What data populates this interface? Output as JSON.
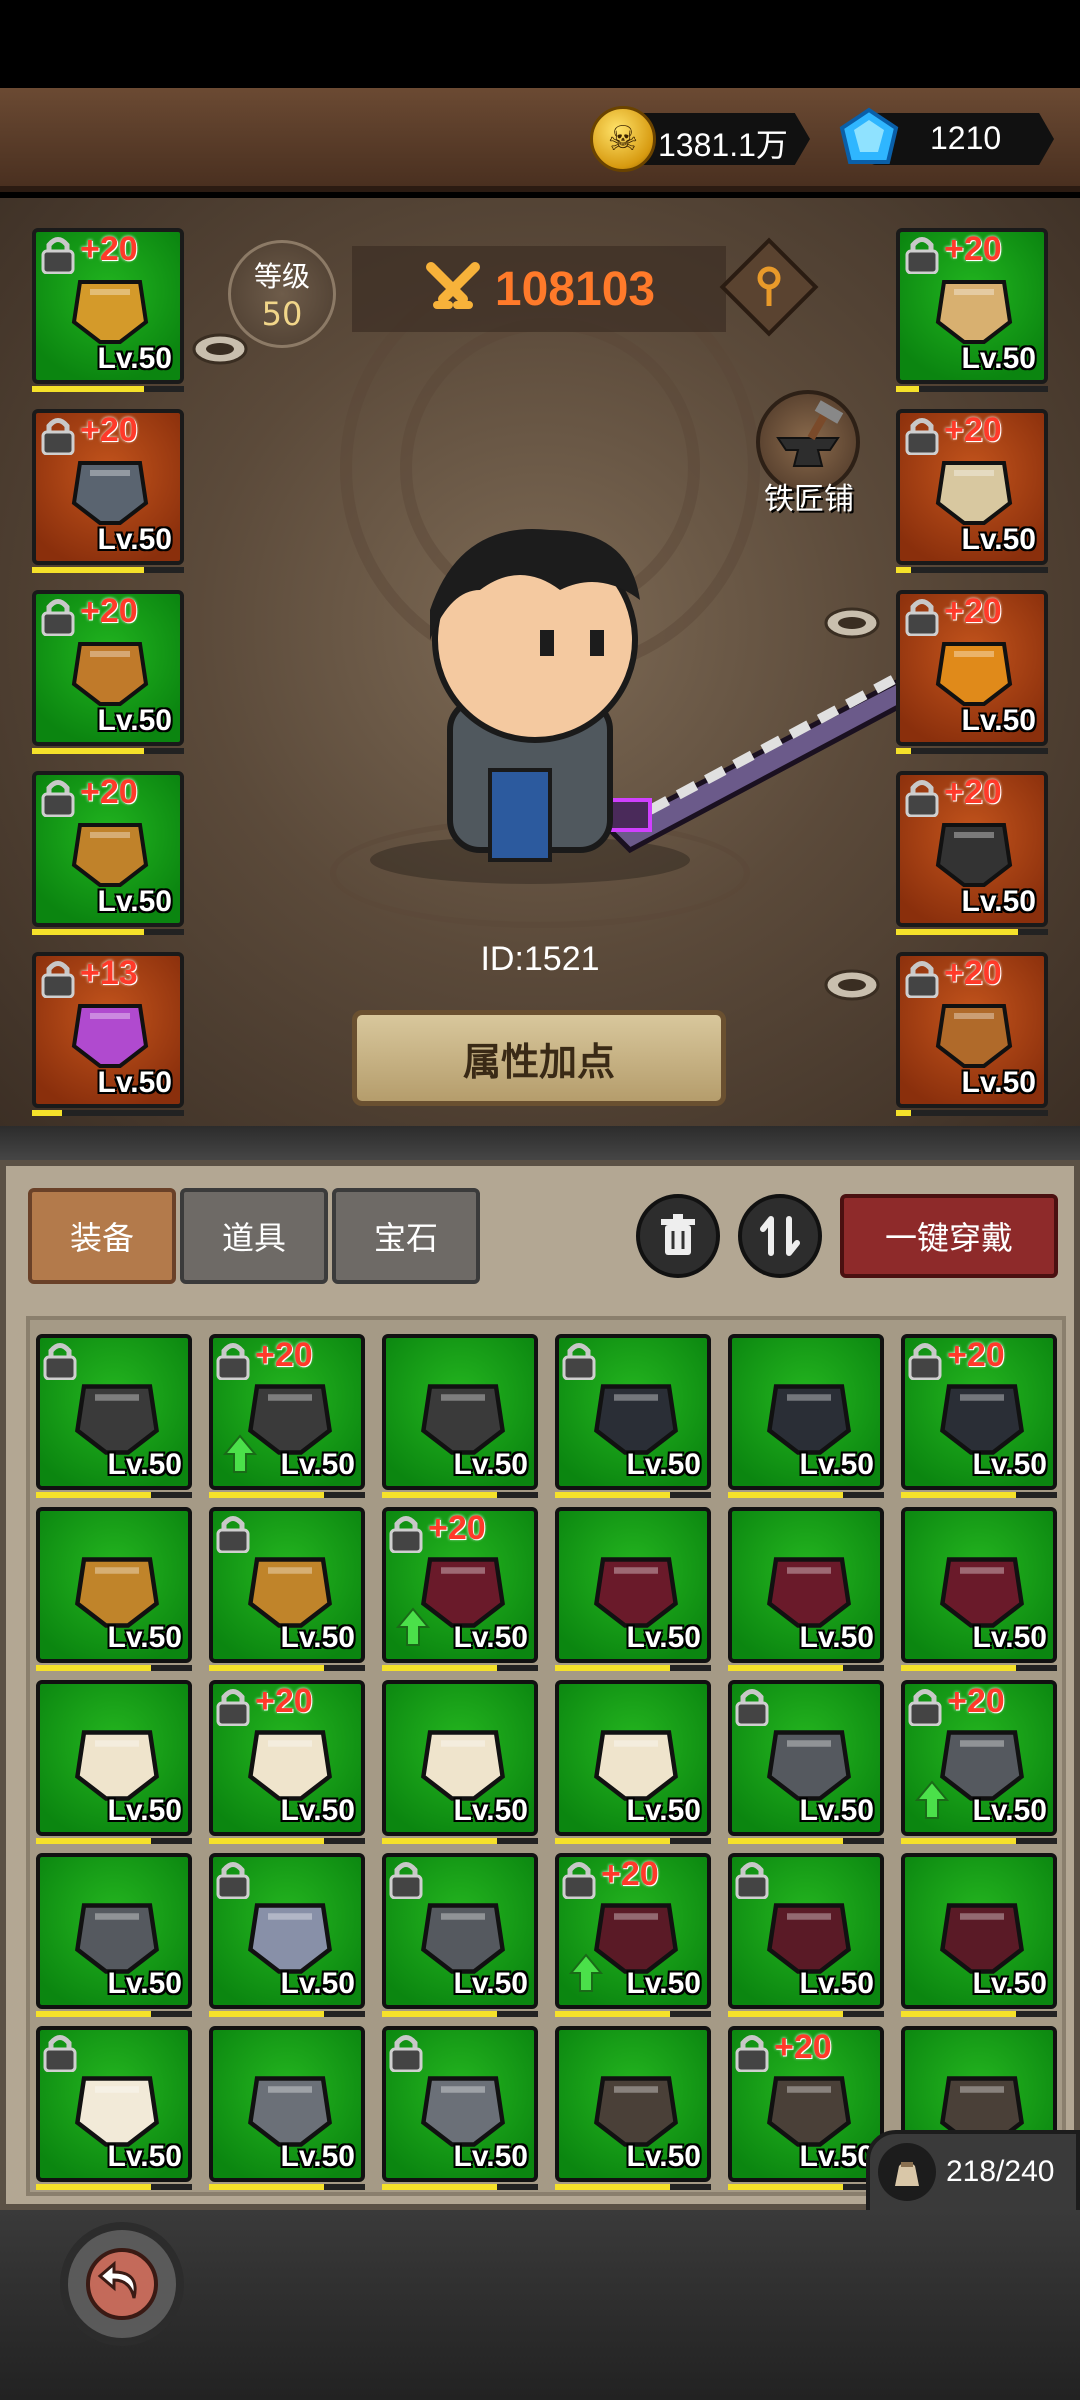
{
  "currency": {
    "gold": "1381.1万",
    "diamonds": "1210"
  },
  "level": {
    "label": "等级",
    "value": "50"
  },
  "combat_power": "108103",
  "blacksmith_label": "铁匠铺",
  "player_id": "ID:1521",
  "attribute_button": "属性加点",
  "left_slots": [
    {
      "enhance": "+20",
      "level": "Lv.50",
      "rarity": "green",
      "item": "helmet",
      "xp": 0.74
    },
    {
      "enhance": "+20",
      "level": "Lv.50",
      "rarity": "orange",
      "item": "shoulder-armor",
      "xp": 0.74
    },
    {
      "enhance": "+20",
      "level": "Lv.50",
      "rarity": "green",
      "item": "leg-armor",
      "xp": 0.74
    },
    {
      "enhance": "+20",
      "level": "Lv.50",
      "rarity": "green",
      "item": "boots",
      "xp": 0.74
    },
    {
      "enhance": "+13",
      "level": "Lv.50",
      "rarity": "orange",
      "item": "flame-sword",
      "xp": 0.2
    }
  ],
  "right_slots": [
    {
      "enhance": "+20",
      "level": "Lv.50",
      "rarity": "green",
      "item": "gauntlets",
      "xp": 0.15
    },
    {
      "enhance": "+20",
      "level": "Lv.50",
      "rarity": "orange",
      "item": "skull-necklace",
      "xp": 0.1
    },
    {
      "enhance": "+20",
      "level": "Lv.50",
      "rarity": "orange",
      "item": "horn",
      "xp": 0.1
    },
    {
      "enhance": "+20",
      "level": "Lv.50",
      "rarity": "orange",
      "item": "dark-ring",
      "xp": 0.8
    },
    {
      "enhance": "+20",
      "level": "Lv.50",
      "rarity": "orange",
      "item": "round-shield",
      "xp": 0.1
    }
  ],
  "tabs": [
    "装备",
    "道具",
    "宝石"
  ],
  "equip_all_button": "一键穿戴",
  "inventory": [
    {
      "level": "Lv.50",
      "enhance": "",
      "lock": true,
      "up": false,
      "item": "belt-dark"
    },
    {
      "level": "Lv.50",
      "enhance": "+20",
      "lock": true,
      "up": true,
      "item": "belt-dark"
    },
    {
      "level": "Lv.50",
      "enhance": "",
      "lock": false,
      "up": false,
      "item": "belt-dark"
    },
    {
      "level": "Lv.50",
      "enhance": "",
      "lock": true,
      "up": false,
      "item": "belt-steel"
    },
    {
      "level": "Lv.50",
      "enhance": "",
      "lock": false,
      "up": false,
      "item": "belt-steel"
    },
    {
      "level": "Lv.50",
      "enhance": "+20",
      "lock": true,
      "up": false,
      "item": "belt-steel"
    },
    {
      "level": "Lv.50",
      "enhance": "",
      "lock": false,
      "up": false,
      "item": "gold-skirt"
    },
    {
      "level": "Lv.50",
      "enhance": "",
      "lock": true,
      "up": false,
      "item": "gold-skirt"
    },
    {
      "level": "Lv.50",
      "enhance": "+20",
      "lock": true,
      "up": true,
      "item": "crimson-pants"
    },
    {
      "level": "Lv.50",
      "enhance": "",
      "lock": false,
      "up": false,
      "item": "crimson-pants"
    },
    {
      "level": "Lv.50",
      "enhance": "",
      "lock": false,
      "up": false,
      "item": "crimson-pants"
    },
    {
      "level": "Lv.50",
      "enhance": "",
      "lock": false,
      "up": false,
      "item": "crimson-pants"
    },
    {
      "level": "Lv.50",
      "enhance": "",
      "lock": false,
      "up": false,
      "item": "white-pants"
    },
    {
      "level": "Lv.50",
      "enhance": "+20",
      "lock": true,
      "up": false,
      "item": "white-pants"
    },
    {
      "level": "Lv.50",
      "enhance": "",
      "lock": false,
      "up": false,
      "item": "white-pants"
    },
    {
      "level": "Lv.50",
      "enhance": "",
      "lock": false,
      "up": false,
      "item": "white-pants"
    },
    {
      "level": "Lv.50",
      "enhance": "",
      "lock": true,
      "up": false,
      "item": "steel-gauntlet"
    },
    {
      "level": "Lv.50",
      "enhance": "+20",
      "lock": true,
      "up": true,
      "item": "steel-gauntlet"
    },
    {
      "level": "Lv.50",
      "enhance": "",
      "lock": false,
      "up": false,
      "item": "steel-gauntlet"
    },
    {
      "level": "Lv.50",
      "enhance": "",
      "lock": true,
      "up": false,
      "item": "blue-gauntlet"
    },
    {
      "level": "Lv.50",
      "enhance": "",
      "lock": true,
      "up": false,
      "item": "steel-gauntlet"
    },
    {
      "level": "Lv.50",
      "enhance": "+20",
      "lock": true,
      "up": true,
      "item": "crimson-gauntlet"
    },
    {
      "level": "Lv.50",
      "enhance": "",
      "lock": true,
      "up": false,
      "item": "crimson-gauntlet"
    },
    {
      "level": "Lv.50",
      "enhance": "",
      "lock": false,
      "up": false,
      "item": "crimson-gauntlet"
    },
    {
      "level": "Lv.50",
      "enhance": "",
      "lock": true,
      "up": false,
      "item": "white-boot"
    },
    {
      "level": "Lv.50",
      "enhance": "",
      "lock": false,
      "up": false,
      "item": "steel-boot"
    },
    {
      "level": "Lv.50",
      "enhance": "",
      "lock": true,
      "up": false,
      "item": "steel-boot"
    },
    {
      "level": "Lv.50",
      "enhance": "",
      "lock": false,
      "up": false,
      "item": "iron-boot"
    },
    {
      "level": "Lv.50",
      "enhance": "+20",
      "lock": true,
      "up": false,
      "item": "iron-boot"
    },
    {
      "level": "Lv.50",
      "enhance": "",
      "lock": false,
      "up": false,
      "item": "iron-boot"
    }
  ],
  "capacity": "218/240",
  "colors": {
    "rarity_green": "#12a016",
    "rarity_orange": "#a8401a",
    "enhance_red": "#ff3a2a",
    "power_orange": "#ff7a2a",
    "accent_red": "#8e2a2a"
  },
  "icons": [
    "skull-coin-icon",
    "diamond-icon",
    "crossed-swords-icon",
    "key-icon",
    "anvil-icon",
    "trash-icon",
    "sort-icon",
    "bag-icon",
    "back-icon",
    "lock-icon",
    "eye-icon",
    "up-arrow-icon"
  ]
}
